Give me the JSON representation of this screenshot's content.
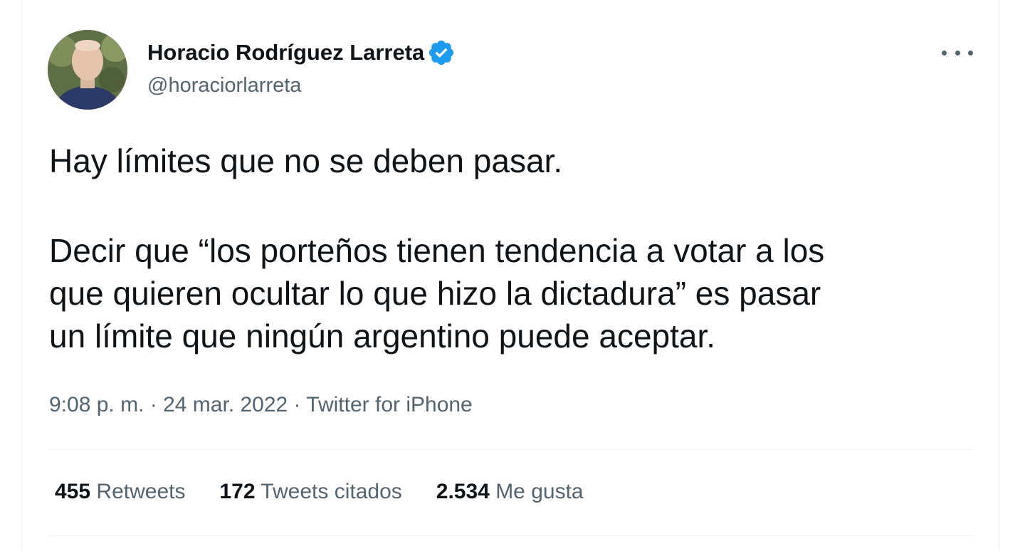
{
  "author": {
    "name": "Horacio Rodríguez Larreta",
    "handle": "@horaciorlarreta",
    "verified_color": "#1d9bf0"
  },
  "tweet": {
    "paragraph1": "Hay límites que no se deben pasar.",
    "paragraph2_lines": [
      "Decir que “los porteños tienen tendencia a votar a los",
      "que quieren ocultar lo que hizo la dictadura” es pasar",
      "un límite que ningún argentino puede aceptar."
    ]
  },
  "meta": {
    "text": "9:08 p. m. · 24 mar. 2022 · Twitter for iPhone"
  },
  "stats": {
    "retweets_count": "455",
    "retweets_label": "Retweets",
    "quotes_count": "172",
    "quotes_label": "Tweets citados",
    "likes_count": "2.534",
    "likes_label": "Me gusta"
  },
  "icons": {
    "more": "more-options-icon",
    "verified": "verified-badge-icon"
  }
}
